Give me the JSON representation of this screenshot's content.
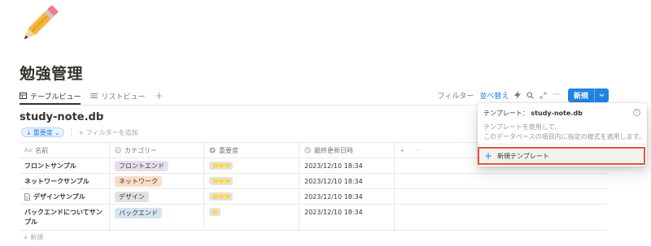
{
  "page": {
    "title": "勉強管理",
    "icon": "pencil-icon"
  },
  "views": {
    "tabs": [
      {
        "label": "テーブルビュー",
        "icon": "table-icon",
        "active": true
      },
      {
        "label": "リストビュー",
        "icon": "list-icon",
        "active": false
      }
    ],
    "add_label": "+"
  },
  "toolbar": {
    "filter_label": "フィルター",
    "sort_label": "並べ替え",
    "new_label": "新規",
    "icons": [
      "lightning-icon",
      "search-icon",
      "expand-icon",
      "more-icon"
    ]
  },
  "database": {
    "title": "study-note.db",
    "more": "···"
  },
  "filters": {
    "sort_chip": "重要度",
    "add_filter": "+ フィルターを追加"
  },
  "table": {
    "columns": [
      {
        "label": "名前",
        "icon": "Aa"
      },
      {
        "label": "カテゴリー",
        "icon": "select-icon"
      },
      {
        "label": "重要度",
        "icon": "status-icon"
      },
      {
        "label": "最終更新日時",
        "icon": "clock-icon"
      }
    ],
    "rows": [
      {
        "name": "フロントサンプル",
        "category": "フロントエンド",
        "category_color": "#e8deee",
        "stars": "⭐⭐⭐",
        "updated": "2023/12/10 18:34",
        "has_doc_icon": false
      },
      {
        "name": "ネットワークサンプル",
        "category": "ネットワーク",
        "category_color": "#fadec9",
        "stars": "⭐⭐⭐",
        "updated": "2023/12/10 18:34",
        "has_doc_icon": false
      },
      {
        "name": "デザインサンプル",
        "category": "デザイン",
        "category_color": "#e3e2e0",
        "stars": "⭐⭐⭐",
        "updated": "2023/12/10 18:34",
        "has_doc_icon": true
      },
      {
        "name": "バックエンドについてサンプル",
        "category": "バックエンド",
        "category_color": "#d3e5ef",
        "stars": "⭐",
        "updated": "2023/12/10 18:34",
        "has_doc_icon": false
      }
    ],
    "add_row": "+ 新規"
  },
  "popup": {
    "title_prefix": "テンプレート：",
    "title_db": "study-note.db",
    "desc1": "テンプレートを使用して、",
    "desc2": "このデータベースの項目内に指定の様式を適用します。",
    "new_template": "新規テンプレート"
  },
  "colors": {
    "accent": "#2383e2",
    "highlight_border": "#e0593b"
  }
}
